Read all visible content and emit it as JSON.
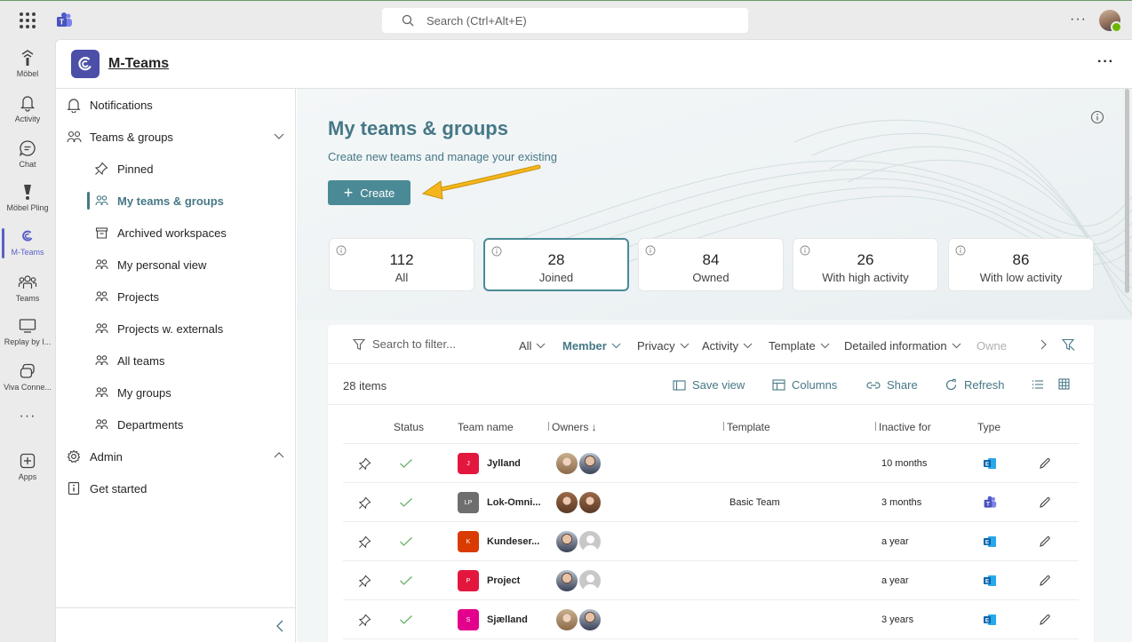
{
  "search": {
    "placeholder": "Search (Ctrl+Alt+E)"
  },
  "rail": [
    {
      "label": "Möbel",
      "icon": "mobel-icon"
    },
    {
      "label": "Activity",
      "icon": "bell-icon"
    },
    {
      "label": "Chat",
      "icon": "chat-icon"
    },
    {
      "label": "Möbel Pling",
      "icon": "pling-icon"
    },
    {
      "label": "M-Teams",
      "icon": "m-teams-icon",
      "active": true
    },
    {
      "label": "Teams",
      "icon": "teams-icon"
    },
    {
      "label": "Replay by I...",
      "icon": "replay-icon"
    },
    {
      "label": "Viva Conne...",
      "icon": "viva-icon"
    },
    {
      "label": "Apps",
      "icon": "apps-icon"
    }
  ],
  "app": {
    "title": "M-Teams"
  },
  "nav": {
    "notifications": "Notifications",
    "teams_groups": "Teams & groups",
    "pinned": "Pinned",
    "my_teams": "My teams & groups",
    "archived": "Archived workspaces",
    "personal_view": "My personal view",
    "projects": "Projects",
    "projects_ext": "Projects w. externals",
    "all_teams": "All teams",
    "my_groups": "My groups",
    "departments": "Departments",
    "admin": "Admin",
    "get_started": "Get started"
  },
  "main": {
    "title": "My teams & groups",
    "subtitle": "Create new teams and manage your existing",
    "create_label": "Create"
  },
  "stats": [
    {
      "value": "112",
      "label": "All"
    },
    {
      "value": "28",
      "label": "Joined",
      "selected": true
    },
    {
      "value": "84",
      "label": "Owned"
    },
    {
      "value": "26",
      "label": "With high activity"
    },
    {
      "value": "86",
      "label": "With low activity"
    }
  ],
  "filters": {
    "search_placeholder": "Search to filter...",
    "all": "All",
    "member": "Member",
    "privacy": "Privacy",
    "activity": "Activity",
    "template": "Template",
    "detailed": "Detailed information",
    "owners": "Owne"
  },
  "toolbar": {
    "items": "28 items",
    "save_view": "Save view",
    "columns": "Columns",
    "share": "Share",
    "refresh": "Refresh"
  },
  "table": {
    "headers": {
      "status": "Status",
      "team": "Team name",
      "owners": "Owners ↓",
      "template": "Template",
      "inactive": "Inactive for",
      "type": "Type"
    },
    "rows": [
      {
        "initial": "J",
        "color": "#e3173e",
        "name": "Jylland",
        "owners": [
          "woman",
          "man"
        ],
        "template": "",
        "inactive": "10 months",
        "type": "exchange"
      },
      {
        "initial": "LP",
        "color": "#6e6e6e",
        "name": "Lok-Omni...",
        "owners": [
          "woman2",
          "woman2"
        ],
        "template": "Basic Team",
        "inactive": "3 months",
        "type": "teams"
      },
      {
        "initial": "K",
        "color": "#da3b01",
        "name": "Kundeser...",
        "owners": [
          "man",
          "blank"
        ],
        "template": "",
        "inactive": "a year",
        "type": "exchange"
      },
      {
        "initial": "P",
        "color": "#e3173e",
        "name": "Project",
        "owners": [
          "man",
          "blank"
        ],
        "template": "",
        "inactive": "a year",
        "type": "exchange"
      },
      {
        "initial": "S",
        "color": "#e3008c",
        "name": "Sjælland",
        "owners": [
          "woman",
          "man"
        ],
        "template": "",
        "inactive": "3 years",
        "type": "exchange"
      }
    ]
  }
}
